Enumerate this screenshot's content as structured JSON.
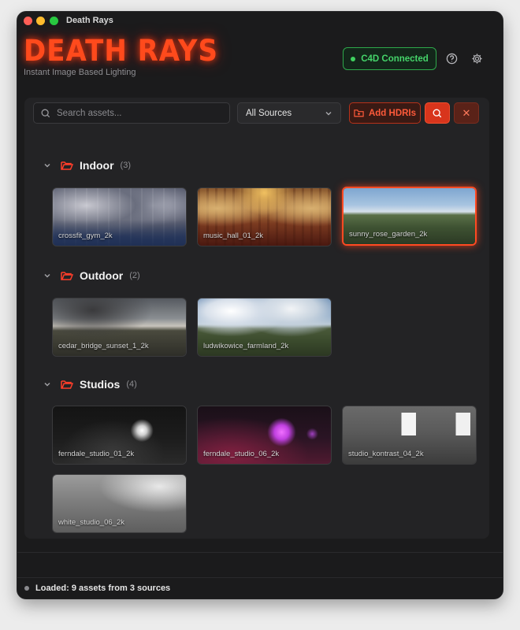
{
  "window": {
    "title": "Death Rays"
  },
  "header": {
    "logo": "DEATH RAYS",
    "tagline": "Instant Image Based Lighting",
    "connection_status": "C4D Connected"
  },
  "toolbar": {
    "search_placeholder": "Search assets...",
    "source_filter": "All Sources",
    "add_button": "Add HDRIs"
  },
  "categories": [
    {
      "name": "Indoor",
      "count": "(3)",
      "assets": [
        "crossfit_gym_2k",
        "music_hall_01_2k",
        "sunny_rose_garden_2k"
      ],
      "selected": "sunny_rose_garden_2k"
    },
    {
      "name": "Outdoor",
      "count": "(2)",
      "assets": [
        "cedar_bridge_sunset_1_2k",
        "ludwikowice_farmland_2k"
      ]
    },
    {
      "name": "Studios",
      "count": "(4)",
      "assets": [
        "ferndale_studio_01_2k",
        "ferndale_studio_06_2k",
        "studio_kontrast_04_2k",
        "white_studio_06_2k"
      ]
    }
  ],
  "status_bar": {
    "message": "Loaded: 9 assets from 3 sources"
  },
  "colors": {
    "accent": "#ff4a22",
    "connected": "#45d46a",
    "background": "#1b1b1c"
  }
}
